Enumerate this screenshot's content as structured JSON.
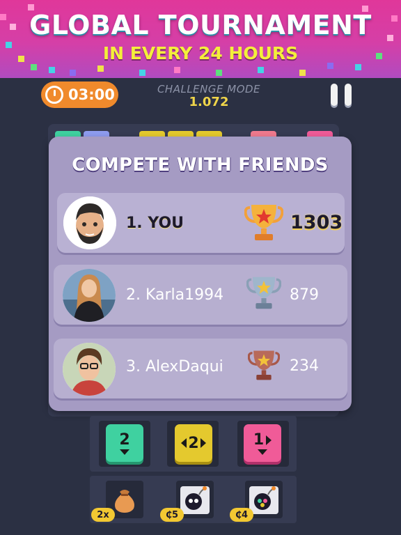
{
  "banner": {
    "title": "GLOBAL TOURNAMENT",
    "subtitle": "IN EVERY 24 HOURS"
  },
  "topbar": {
    "timer": "03:00",
    "mode_label": "CHALLENGE MODE",
    "mode_value": "1.072"
  },
  "leaderboard": {
    "title": "COMPETE WITH FRIENDS",
    "rows": [
      {
        "rank_name": "1. YOU",
        "score": "1303",
        "trophy": "gold-trophy-icon"
      },
      {
        "rank_name": "2. Karla1994",
        "score": "879",
        "trophy": "silver-trophy-icon"
      },
      {
        "rank_name": "3. AlexDaqui",
        "score": "234",
        "trophy": "bronze-trophy-icon"
      }
    ]
  },
  "queue": {
    "tiles": [
      {
        "value": "2",
        "color": "#3fd1a0",
        "arrow": "down"
      },
      {
        "value": "2",
        "color": "#e4c92e",
        "arrow": "left-right"
      },
      {
        "value": "1",
        "color": "#f05b98",
        "arrow": "right-down"
      }
    ]
  },
  "powerups": [
    {
      "icon": "coin-bag-icon",
      "badge": "2x"
    },
    {
      "icon": "bomb-icon",
      "badge": "₵5"
    },
    {
      "icon": "color-bomb-icon",
      "badge": "₵4"
    }
  ],
  "colors": {
    "background": "#2b3043",
    "banner_pink": "#e0379a",
    "card": "#a59bc3",
    "timer_orange": "#f08a2c",
    "gold": "#f0d54a"
  }
}
